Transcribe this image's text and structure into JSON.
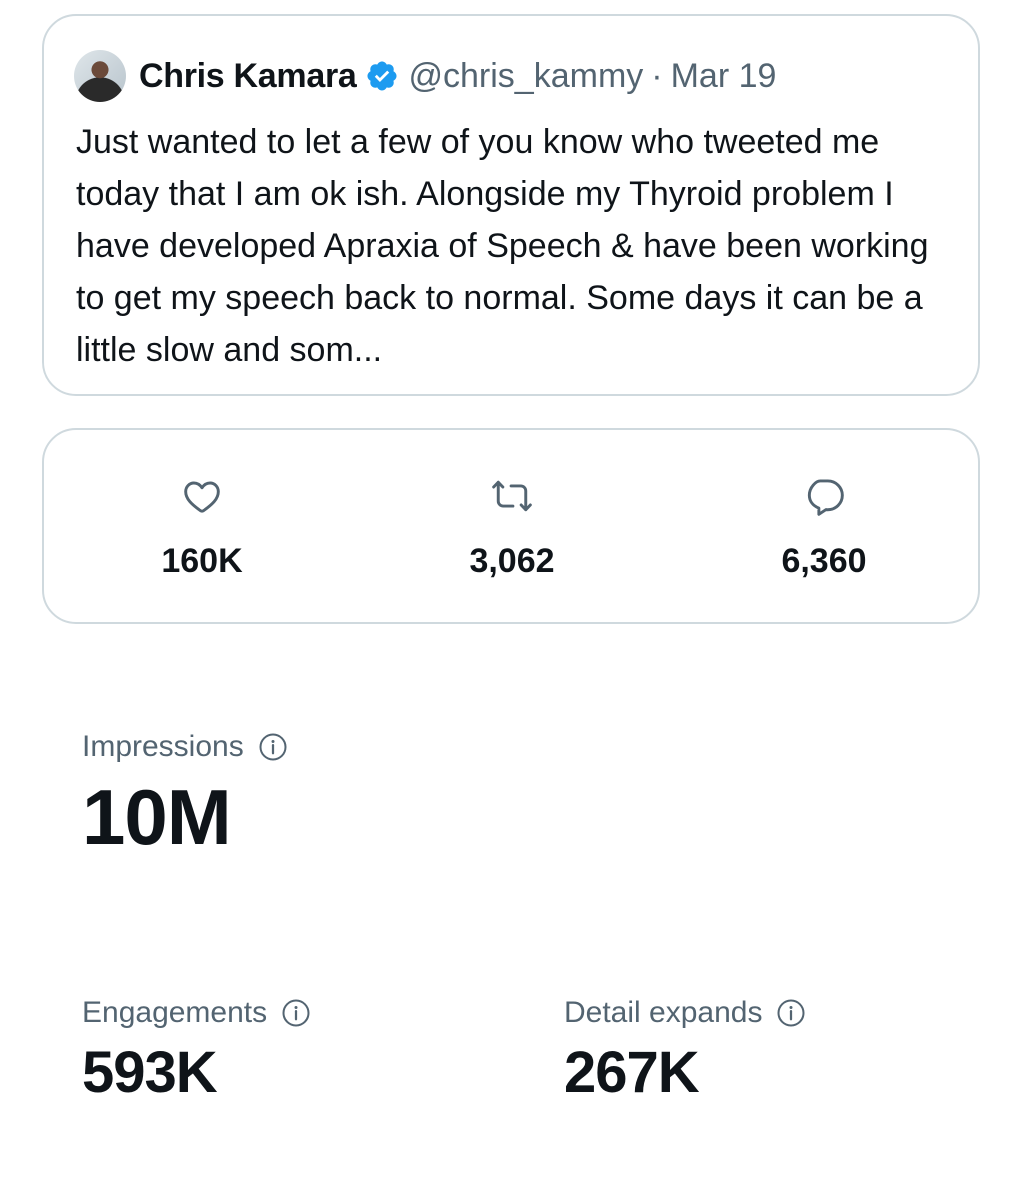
{
  "tweet": {
    "author_name": "Chris Kamara",
    "handle": "@chris_kammy",
    "separator": "·",
    "date": "Mar 19",
    "text": "Just wanted to let a few of you know who tweeted me today that I am ok ish. Alongside my Thyroid problem I have developed Apraxia of Speech & have been working to get my speech back to normal. Some days it can be a little slow and som...",
    "verified_color": "#1d9bf0"
  },
  "actions": {
    "likes": {
      "icon": "heart-icon",
      "count": "160K"
    },
    "retweets": {
      "icon": "retweet-icon",
      "count": "3,062"
    },
    "replies": {
      "icon": "reply-icon",
      "count": "6,360"
    }
  },
  "metrics": {
    "impressions": {
      "label": "Impressions",
      "value": "10M"
    },
    "engagements": {
      "label": "Engagements",
      "value": "593K"
    },
    "detail_expands": {
      "label": "Detail expands",
      "value": "267K"
    }
  },
  "colors": {
    "text_primary": "#0f1419",
    "text_secondary": "#536471",
    "border": "#cfd9de",
    "accent": "#1d9bf0"
  }
}
